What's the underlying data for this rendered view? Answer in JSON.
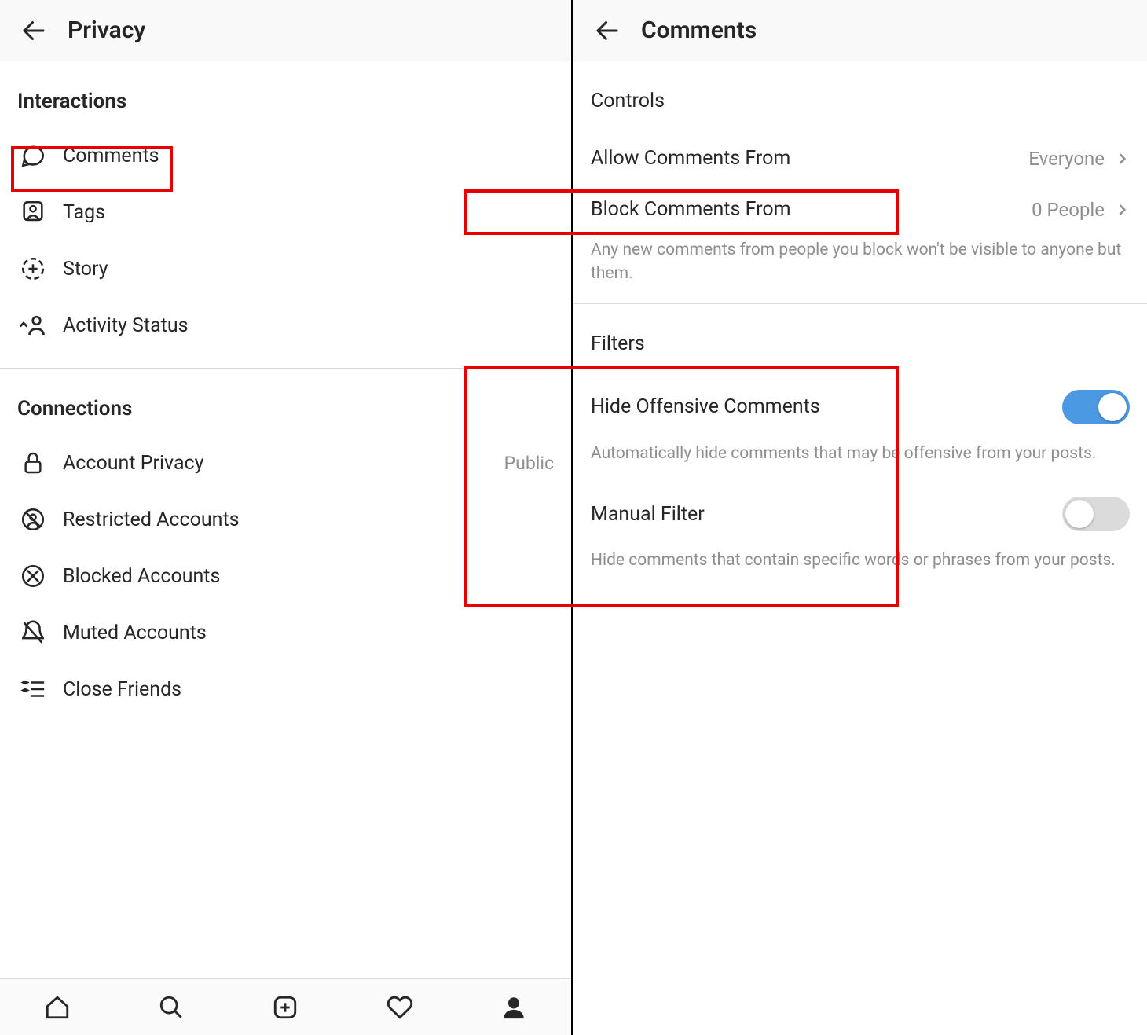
{
  "left": {
    "headerTitle": "Privacy",
    "sections": {
      "interactions": {
        "title": "Interactions",
        "items": {
          "comments": "Comments",
          "tags": "Tags",
          "story": "Story",
          "activityStatus": "Activity Status"
        }
      },
      "connections": {
        "title": "Connections",
        "items": {
          "accountPrivacy": {
            "label": "Account Privacy",
            "value": "Public"
          },
          "restrictedAccounts": "Restricted Accounts",
          "blockedAccounts": "Blocked Accounts",
          "mutedAccounts": "Muted Accounts",
          "closeFriends": "Close Friends"
        }
      }
    }
  },
  "right": {
    "headerTitle": "Comments",
    "controls": {
      "title": "Controls",
      "allowFrom": {
        "label": "Allow Comments From",
        "value": "Everyone"
      },
      "blockFrom": {
        "label": "Block Comments From",
        "value": "0 People"
      },
      "blockDesc": "Any new comments from people you block won't be visible to anyone but them."
    },
    "filters": {
      "title": "Filters",
      "hideOffensive": {
        "label": "Hide Offensive Comments",
        "enabled": true,
        "desc": "Automatically hide comments that may be offensive from your posts."
      },
      "manualFilter": {
        "label": "Manual Filter",
        "enabled": false,
        "desc": "Hide comments that contain specific words or phrases from your posts."
      }
    }
  }
}
